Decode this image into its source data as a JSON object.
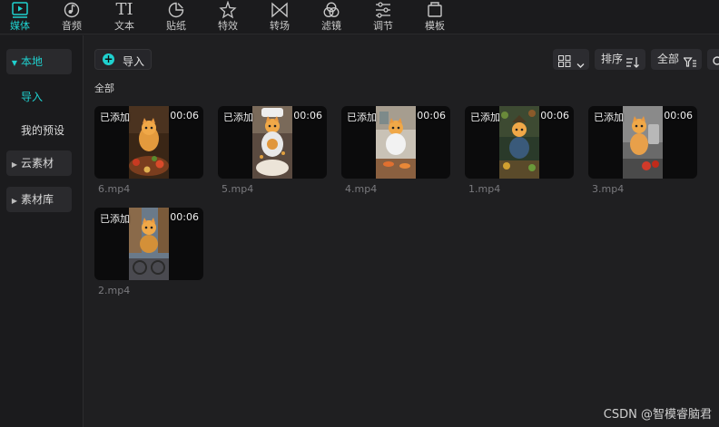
{
  "toolbar": {
    "items": [
      {
        "label": "媒体",
        "icon": "media-play-icon",
        "active": true
      },
      {
        "label": "音频",
        "icon": "audio-icon",
        "active": false
      },
      {
        "label": "文本",
        "icon": "text-icon",
        "active": false
      },
      {
        "label": "贴纸",
        "icon": "sticker-icon",
        "active": false
      },
      {
        "label": "特效",
        "icon": "effects-star-icon",
        "active": false
      },
      {
        "label": "转场",
        "icon": "transition-icon",
        "active": false
      },
      {
        "label": "滤镜",
        "icon": "filter-icon",
        "active": false
      },
      {
        "label": "调节",
        "icon": "adjust-sliders-icon",
        "active": false
      },
      {
        "label": "模板",
        "icon": "template-icon",
        "active": false
      }
    ],
    "text_icon_glyph": "TI"
  },
  "sidebar": {
    "local": "本地",
    "import": "导入",
    "my_presets": "我的预设",
    "cloud": "云素材",
    "library": "素材库"
  },
  "content": {
    "import_button": "导入",
    "sort_label": "排序",
    "filter_label": "全部",
    "section_label": "全部",
    "items": [
      {
        "added": "已添加",
        "duration": "00:06",
        "filename": "6.mp4"
      },
      {
        "added": "已添加",
        "duration": "00:06",
        "filename": "5.mp4"
      },
      {
        "added": "已添加",
        "duration": "00:06",
        "filename": "4.mp4"
      },
      {
        "added": "已添加",
        "duration": "00:06",
        "filename": "1.mp4"
      },
      {
        "added": "已添加",
        "duration": "00:06",
        "filename": "3.mp4"
      },
      {
        "added": "已添加",
        "duration": "00:06",
        "filename": "2.mp4"
      }
    ]
  },
  "watermark": "CSDN @智模睿脑君",
  "colors": {
    "accent": "#1fd1cf",
    "background": "#1f1f21",
    "panel": "#1b1b1d"
  }
}
